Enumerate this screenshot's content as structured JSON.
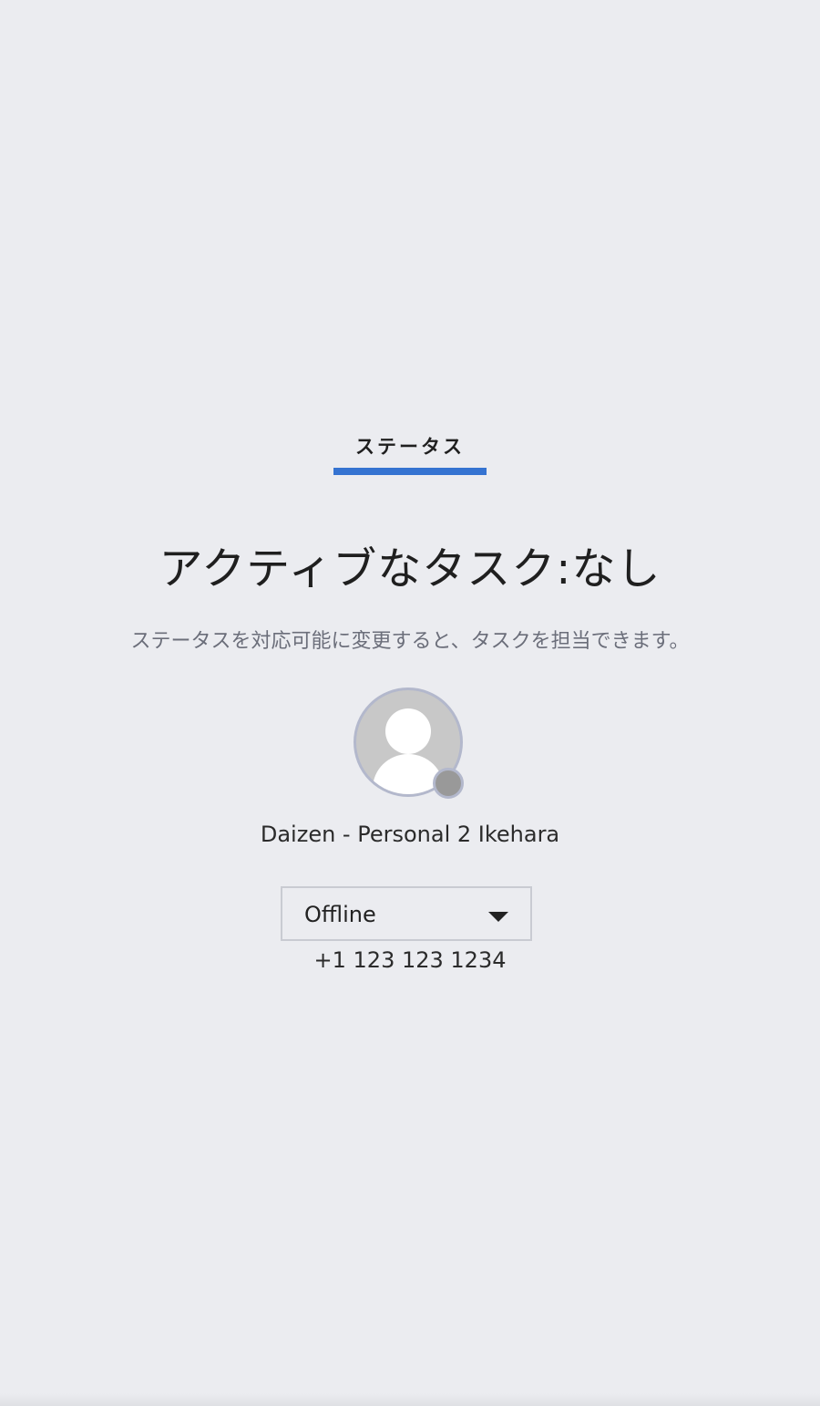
{
  "tabs": [
    {
      "label": "ステータス",
      "active": true
    }
  ],
  "main": {
    "title": "アクティブなタスク:なし",
    "subtitle": "ステータスを対応可能に変更すると、タスクを担当できます。"
  },
  "user": {
    "name": "Daizen - Personal 2 Ikehara",
    "avatar_icon": "user-silhouette-icon",
    "status_indicator_color": "#999999"
  },
  "status_select": {
    "value": "Offline",
    "icon": "chevron-down-icon"
  },
  "phone": "+1 123 123 1234",
  "colors": {
    "background": "#ebecf0",
    "accent": "#3573d1"
  }
}
